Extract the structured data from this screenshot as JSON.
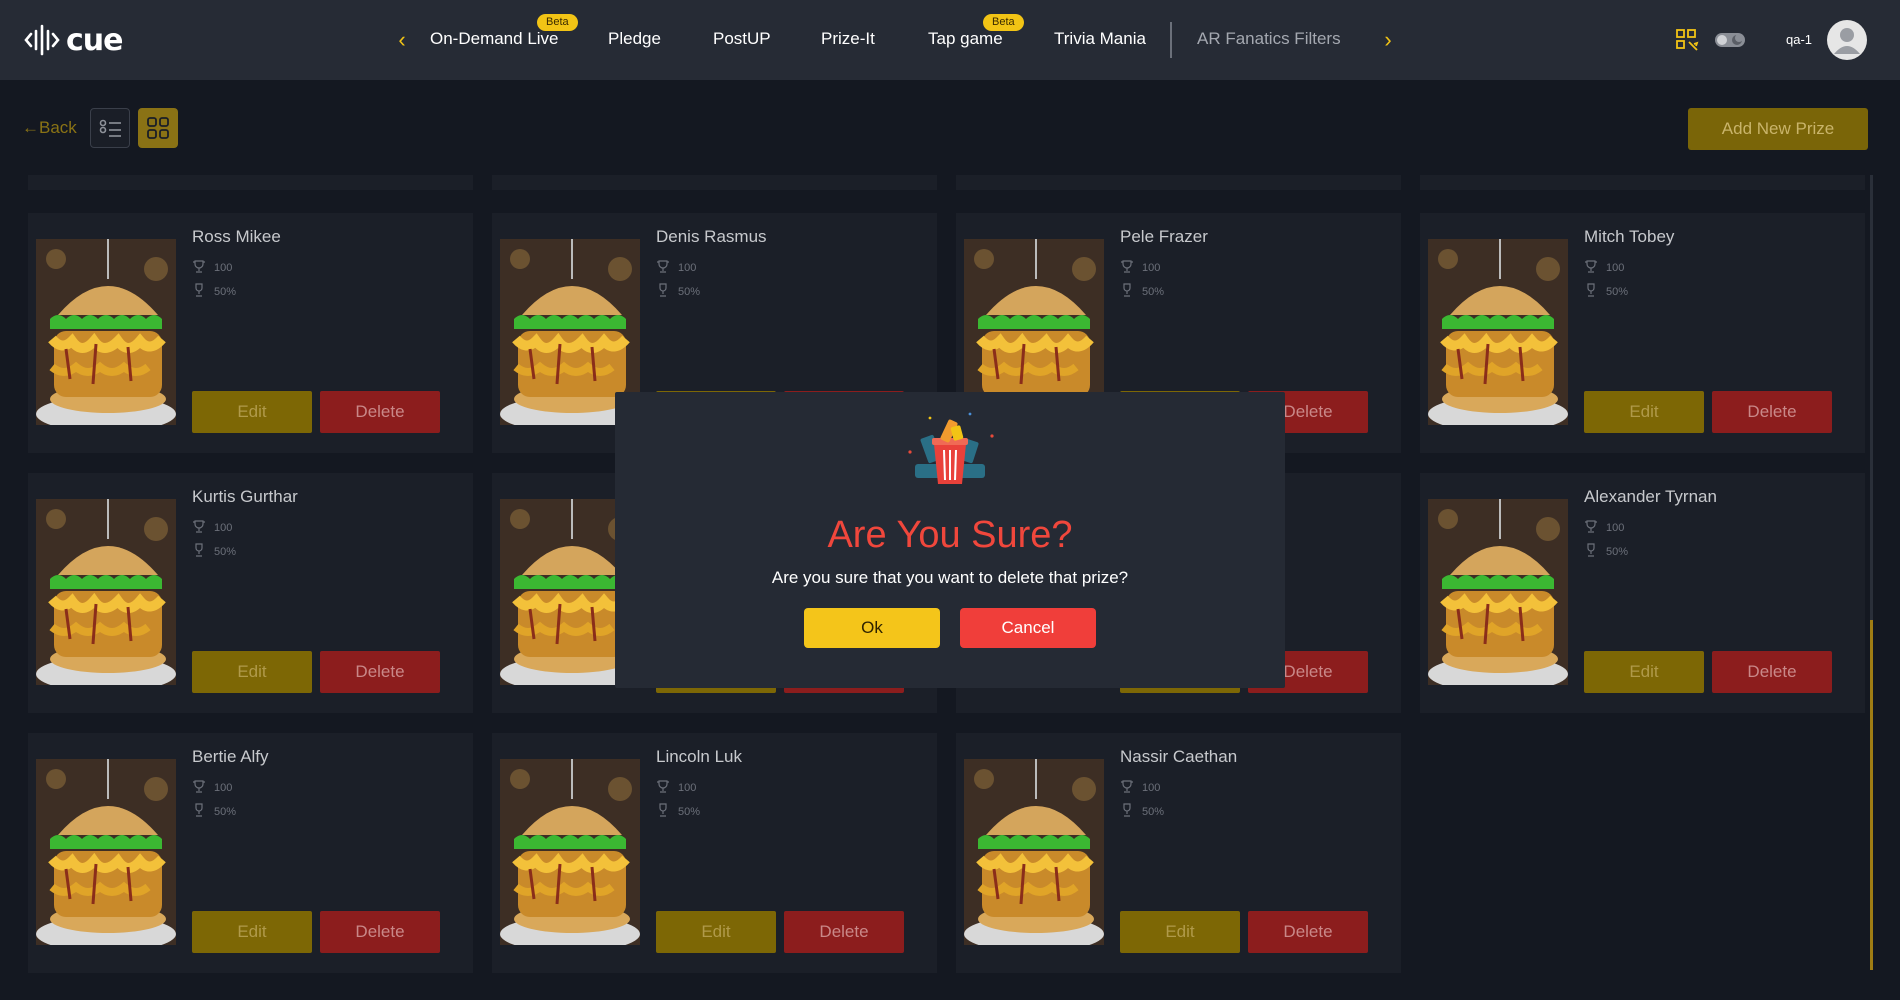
{
  "brand": {
    "logo_text": "cue"
  },
  "nav": {
    "items": [
      {
        "label": "On-Demand Live",
        "badge": "Beta"
      },
      {
        "label": "Pledge",
        "badge": ""
      },
      {
        "label": "PostUP",
        "badge": ""
      },
      {
        "label": "Prize-It",
        "badge": ""
      },
      {
        "label": "Tap game",
        "badge": "Beta"
      },
      {
        "label": "Trivia Mania",
        "badge": ""
      },
      {
        "label": "AR Fanatics Filters",
        "badge": ""
      }
    ],
    "prev_icon": "chevron-left-icon",
    "next_icon": "chevron-right-icon"
  },
  "header_tools": {
    "qr_icon": "qr-code-icon",
    "toggle_icon": "theme-toggle-icon"
  },
  "user": {
    "name": "qa-1",
    "avatar_icon": "user-avatar-icon"
  },
  "toolbar": {
    "back_label": "←Back",
    "add_label": "Add New Prize"
  },
  "prizes": [
    {
      "name": "Ross Mikee",
      "points": "100",
      "percent": "50%"
    },
    {
      "name": "Denis Rasmus",
      "points": "100",
      "percent": "50%"
    },
    {
      "name": "Pele Frazer",
      "points": "100",
      "percent": "50%"
    },
    {
      "name": "Mitch Tobey",
      "points": "100",
      "percent": "50%"
    },
    {
      "name": "Kurtis Gurthar",
      "points": "100",
      "percent": "50%"
    },
    {
      "name": "",
      "points": "",
      "percent": ""
    },
    {
      "name": "",
      "points": "",
      "percent": ""
    },
    {
      "name": "Alexander Tyrnan",
      "points": "100",
      "percent": "50%"
    },
    {
      "name": "Bertie Alfy",
      "points": "100",
      "percent": "50%"
    },
    {
      "name": "Lincoln Luk",
      "points": "100",
      "percent": "50%"
    },
    {
      "name": "Nassir Caethan",
      "points": "100",
      "percent": "50%"
    }
  ],
  "card_buttons": {
    "edit": "Edit",
    "delete": "Delete"
  },
  "modal": {
    "title": "Are You Sure?",
    "message": "Are you sure that you want to delete that prize?",
    "ok_label": "Ok",
    "cancel_label": "Cancel",
    "icon": "trash-bin-icon"
  },
  "colors": {
    "accent": "#f2c415",
    "danger": "#f03e3a",
    "topbar": "#262b35",
    "background": "#141821"
  }
}
